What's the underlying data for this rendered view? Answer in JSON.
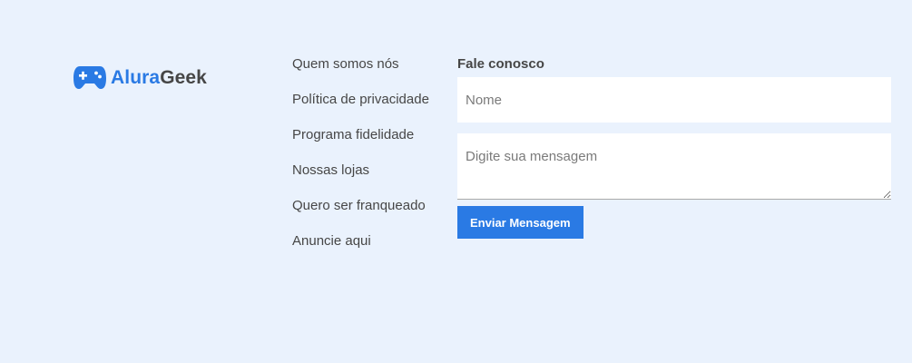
{
  "brand": {
    "name_part1": "Alura",
    "name_part2": "Geek",
    "icon": "gamepad-icon",
    "primary_color": "#2A7AE4",
    "text_color": "#464646"
  },
  "footer_links": [
    "Quem somos nós",
    "Política de privacidade",
    "Programa fidelidade",
    "Nossas lojas",
    "Quero ser franqueado",
    "Anuncie aqui"
  ],
  "contact": {
    "title": "Fale conosco",
    "name_placeholder": "Nome",
    "message_placeholder": "Digite sua mensagem",
    "submit_label": "Enviar Mensagem"
  },
  "colors": {
    "background": "#EAF2FD",
    "button": "#2A7AE4",
    "field_background": "#FFFFFF"
  }
}
